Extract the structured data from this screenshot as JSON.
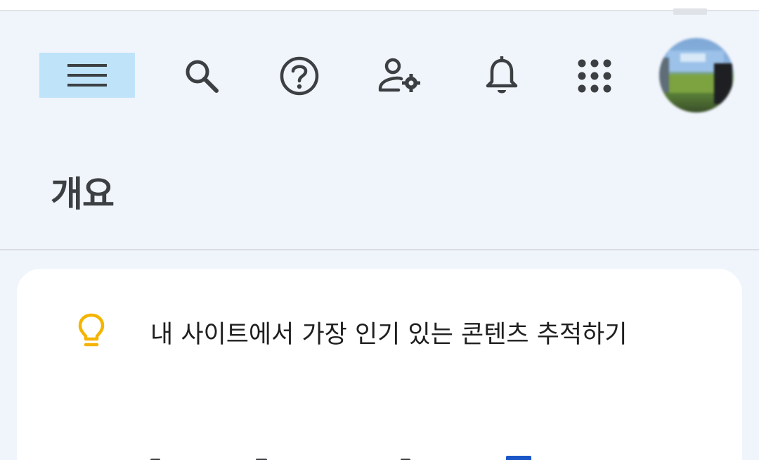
{
  "toolbar": {
    "icons": [
      "menu-icon",
      "search-icon",
      "help-icon",
      "admin-settings-icon",
      "notifications-icon",
      "apps-grid-icon",
      "avatar"
    ]
  },
  "page": {
    "title": "개요"
  },
  "card": {
    "tip_icon": "lightbulb-icon",
    "tip_text": "내 사이트에서 가장 인기 있는 콘텐츠 추적하기"
  },
  "colors": {
    "background": "#f0f4fb",
    "card": "#ffffff",
    "menu_highlight": "#bfe3f9",
    "bulb": "#f4b400",
    "icon": "#3c4043"
  }
}
